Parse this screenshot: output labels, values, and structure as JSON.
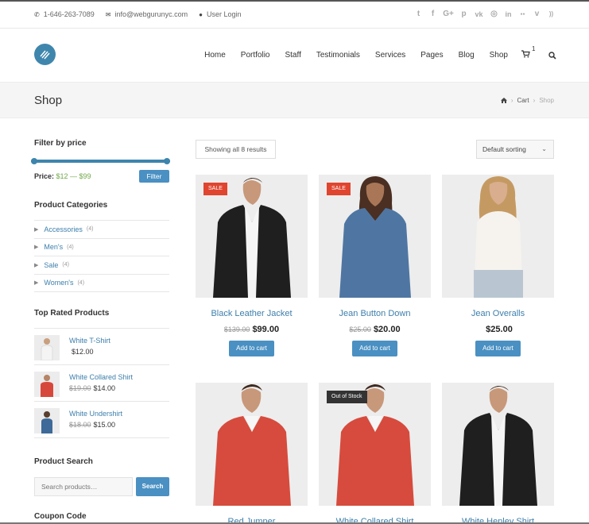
{
  "topbar": {
    "phone": "1-646-263-7089",
    "email": "info@webgurunyc.com",
    "login": "User Login",
    "social": [
      "twitter-icon",
      "facebook-icon",
      "google-plus-icon",
      "pinterest-icon",
      "vk-icon",
      "instagram-icon",
      "linkedin-icon",
      "flickr-icon",
      "vimeo-icon",
      "rss-icon"
    ],
    "social_glyphs": [
      "t",
      "f",
      "G+",
      "p",
      "vk",
      "◎",
      "in",
      "●●",
      "v",
      "))"
    ]
  },
  "nav": {
    "items": [
      "Home",
      "Portfolio",
      "Staff",
      "Testimonials",
      "Services",
      "Pages",
      "Blog",
      "Shop"
    ],
    "cart_count": "1"
  },
  "page": {
    "title": "Shop",
    "breadcrumb": [
      "Cart",
      "Shop"
    ]
  },
  "sidebar": {
    "filter_title": "Filter by price",
    "price_label": "Price:",
    "price_range": "$12 — $99",
    "filter_button": "Filter",
    "categories_title": "Product Categories",
    "categories": [
      {
        "label": "Accessories",
        "count": "(4)"
      },
      {
        "label": "Men's",
        "count": "(4)"
      },
      {
        "label": "Sale",
        "count": "(4)"
      },
      {
        "label": "Women's",
        "count": "(4)"
      }
    ],
    "top_rated_title": "Top Rated Products",
    "top_rated": [
      {
        "name": "White T-Shirt",
        "old": "",
        "price": "$12.00"
      },
      {
        "name": "White Collared Shirt",
        "old": "$19.00",
        "price": "$14.00"
      },
      {
        "name": "White Undershirt",
        "old": "$18.00",
        "price": "$15.00"
      }
    ],
    "search_title": "Product Search",
    "search_placeholder": "Search products…",
    "search_button": "Search",
    "coupon_title": "Coupon Code"
  },
  "shop": {
    "result_count": "Showing all 8 results",
    "sorting": "Default sorting",
    "products": [
      {
        "title": "Black Leather Jacket",
        "old": "$139.00",
        "price": "$99.00",
        "badge": "SALE",
        "button": "Add to cart"
      },
      {
        "title": "Jean Button Down",
        "old": "$25.00",
        "price": "$20.00",
        "badge": "SALE",
        "button": "Add to cart"
      },
      {
        "title": "Jean Overalls",
        "old": "",
        "price": "$25.00",
        "badge": "",
        "button": "Add to cart"
      },
      {
        "title": "Red Jumper",
        "old": "",
        "price": "",
        "badge": "",
        "button": ""
      },
      {
        "title": "White Collared Shirt",
        "old": "",
        "price": "",
        "badge": "Out of Stock",
        "button": ""
      },
      {
        "title": "White Henley Shirt",
        "old": "",
        "price": "",
        "badge": "",
        "button": ""
      }
    ]
  },
  "colors": {
    "accent": "#4a90c2",
    "link": "#3d7fab",
    "sale_badge": "#e0452f",
    "price_green": "#6eaa47"
  }
}
